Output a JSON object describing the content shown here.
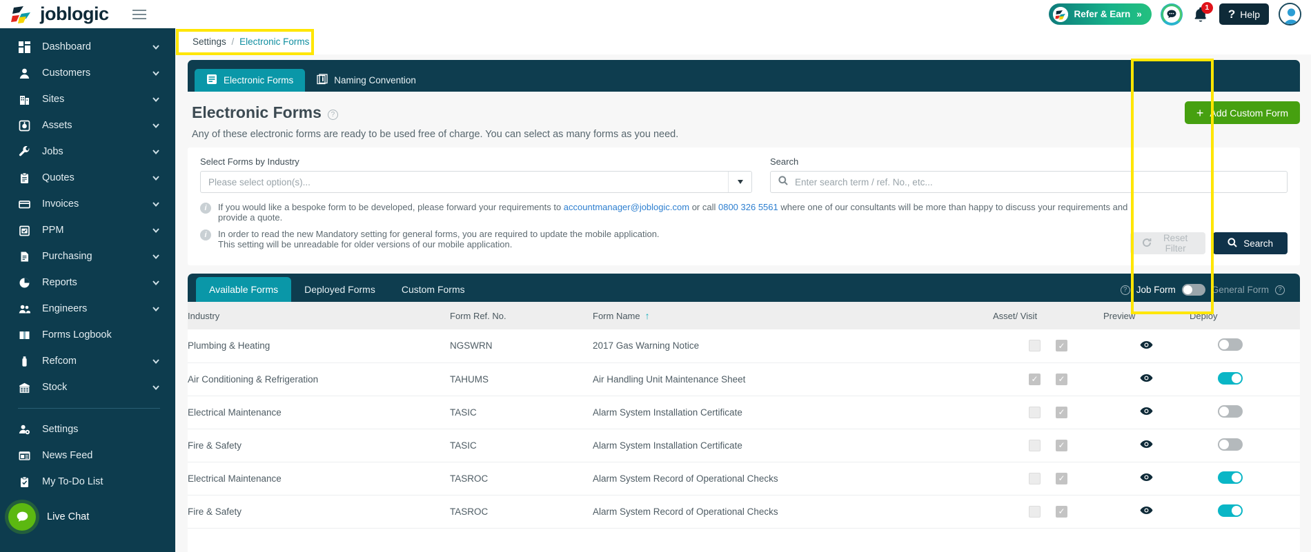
{
  "brand": {
    "name": "joblogic"
  },
  "topbar": {
    "refer_label": "Refer & Earn",
    "refer_chevrons": "»",
    "notification_count": "1",
    "help_label": "Help",
    "help_mark": "?"
  },
  "sidebar": {
    "items": [
      {
        "label": "Dashboard",
        "icon": "dashboard-icon",
        "chevron": true
      },
      {
        "label": "Customers",
        "icon": "customers-icon",
        "chevron": true
      },
      {
        "label": "Sites",
        "icon": "sites-icon",
        "chevron": true
      },
      {
        "label": "Assets",
        "icon": "assets-icon",
        "chevron": true
      },
      {
        "label": "Jobs",
        "icon": "jobs-icon",
        "chevron": true
      },
      {
        "label": "Quotes",
        "icon": "quotes-icon",
        "chevron": true
      },
      {
        "label": "Invoices",
        "icon": "invoices-icon",
        "chevron": true
      },
      {
        "label": "PPM",
        "icon": "ppm-icon",
        "chevron": true
      },
      {
        "label": "Purchasing",
        "icon": "purchasing-icon",
        "chevron": true
      },
      {
        "label": "Reports",
        "icon": "reports-icon",
        "chevron": true
      },
      {
        "label": "Engineers",
        "icon": "engineers-icon",
        "chevron": true
      },
      {
        "label": "Forms Logbook",
        "icon": "forms-logbook-icon",
        "chevron": false
      },
      {
        "label": "Refcom",
        "icon": "refcom-icon",
        "chevron": true
      },
      {
        "label": "Stock",
        "icon": "stock-icon",
        "chevron": true
      }
    ],
    "bottom_items": [
      {
        "label": "Settings",
        "icon": "settings-icon"
      },
      {
        "label": "News Feed",
        "icon": "news-feed-icon"
      },
      {
        "label": "My To-Do List",
        "icon": "todo-icon"
      }
    ],
    "live_chat": "Live Chat"
  },
  "breadcrumb": {
    "root": "Settings",
    "separator": "/",
    "current": "Electronic Forms"
  },
  "section_tabs": [
    {
      "label": "Electronic Forms",
      "icon": "form-icon",
      "active": true
    },
    {
      "label": "Naming Convention",
      "icon": "info-doc-icon",
      "active": false
    }
  ],
  "page": {
    "title": "Electronic Forms",
    "help_mark": "?",
    "subtitle": "Any of these electronic forms are ready to be used free of charge. You can select as many forms as you need.",
    "add_button": "Add Custom Form",
    "add_plus": "+"
  },
  "filters": {
    "industry_label": "Select Forms by Industry",
    "industry_placeholder": "Please select option(s)...",
    "search_label": "Search",
    "search_placeholder": "Enter search term / ref. No., etc...",
    "search_value": "",
    "info_1_pre": "If you would like a bespoke form to be developed, please forward your requirements to ",
    "info_1_email": "accountmanager@joblogic.com",
    "info_1_mid": " or call ",
    "info_1_phone": "0800 326 5561",
    "info_1_post": " where one of our consultants will be more than happy to discuss your requirements and provide a quote.",
    "info_2_line1": "In order to read the new Mandatory setting for general forms, you are required to update the mobile application.",
    "info_2_line2": "This setting will be unreadable for older versions of our mobile application.",
    "info_mark": "i",
    "reset_label": "Reset Filter",
    "search_button": "Search"
  },
  "table_tabs": [
    {
      "label": "Available Forms",
      "active": true
    },
    {
      "label": "Deployed Forms",
      "active": false
    },
    {
      "label": "Custom Forms",
      "active": false
    }
  ],
  "form_type_toggle": {
    "left_label": "Job Form",
    "right_label": "General Form",
    "help_mark": "?",
    "state": "left"
  },
  "table": {
    "columns": [
      {
        "key": "industry",
        "label": "Industry"
      },
      {
        "key": "ref",
        "label": "Form Ref. No."
      },
      {
        "key": "name",
        "label": "Form Name",
        "sort": "↑"
      },
      {
        "key": "assetvisit",
        "label": "Asset/ Visit"
      },
      {
        "key": "preview",
        "label": "Preview"
      },
      {
        "key": "deploy",
        "label": "Deploy"
      }
    ],
    "rows": [
      {
        "industry": "Plumbing & Heating",
        "ref": "NGSWRN",
        "name": "2017 Gas Warning Notice",
        "asset": false,
        "visit": true,
        "deploy": false
      },
      {
        "industry": "Air Conditioning & Refrigeration",
        "ref": "TAHUMS",
        "name": "Air Handling Unit Maintenance Sheet",
        "asset": true,
        "visit": true,
        "deploy": true
      },
      {
        "industry": "Electrical Maintenance",
        "ref": "TASIC",
        "name": "Alarm System Installation Certificate",
        "asset": false,
        "visit": true,
        "deploy": false
      },
      {
        "industry": "Fire & Safety",
        "ref": "TASIC",
        "name": "Alarm System Installation Certificate",
        "asset": false,
        "visit": true,
        "deploy": false
      },
      {
        "industry": "Electrical Maintenance",
        "ref": "TASROC",
        "name": "Alarm System Record of Operational Checks",
        "asset": false,
        "visit": true,
        "deploy": true
      },
      {
        "industry": "Fire & Safety",
        "ref": "TASROC",
        "name": "Alarm System Record of Operational Checks",
        "asset": false,
        "visit": true,
        "deploy": true
      }
    ]
  },
  "colors": {
    "sidebar_bg": "#0d3c4e",
    "tab_active": "#0a97a8",
    "accent_teal": "#0ab6c6",
    "green_button": "#46a010",
    "highlight_yellow": "#ffe600",
    "link_blue": "#2d7fd0",
    "badge_red": "#e0131a"
  }
}
